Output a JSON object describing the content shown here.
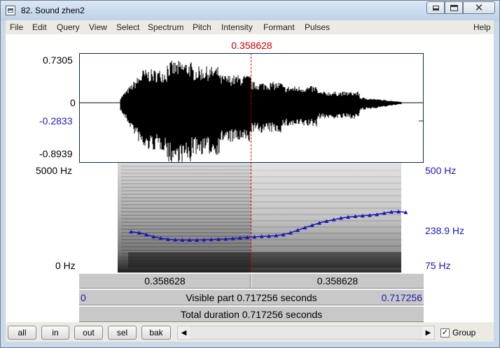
{
  "window": {
    "title": "82. Sound zhen2"
  },
  "menu": {
    "items": [
      "File",
      "Edit",
      "Query",
      "View",
      "Select",
      "Spectrum",
      "Pitch",
      "Intensity",
      "Formant",
      "Pulses"
    ],
    "help": "Help"
  },
  "cursor": {
    "time_label": "0.358628",
    "time": 0.358628
  },
  "waveform": {
    "y_max_label": "0.7305",
    "y_zero_label": "0",
    "y_value_label": "-0.2833",
    "y_min_label": "-0.8939",
    "ylim": [
      -0.8939,
      0.7305
    ]
  },
  "spectrogram": {
    "freq_top_label": "5000 Hz",
    "freq_bottom_label": "0 Hz",
    "pitch_top_label": "500 Hz",
    "pitch_value_label": "238.9 Hz",
    "pitch_bottom_label": "75 Hz",
    "pitch_range": [
      75,
      500
    ]
  },
  "chart_data": {
    "type": "line",
    "ylabel": "",
    "xlim": [
      0,
      0.717256
    ],
    "ylim": [
      75,
      500
    ],
    "series": [
      {
        "color": "#1a1ab5",
        "x": [
          0.108,
          0.125,
          0.14,
          0.155,
          0.17,
          0.185,
          0.2,
          0.215,
          0.23,
          0.245,
          0.26,
          0.275,
          0.29,
          0.305,
          0.32,
          0.335,
          0.35,
          0.365,
          0.38,
          0.395,
          0.41,
          0.425,
          0.44,
          0.455,
          0.47,
          0.485,
          0.5,
          0.515,
          0.53,
          0.545,
          0.56,
          0.575,
          0.59,
          0.605,
          0.62,
          0.635,
          0.65,
          0.665,
          0.68
        ],
        "y": [
          233,
          229,
          222,
          214,
          208,
          204,
          202,
          201,
          201,
          201,
          202,
          203,
          204,
          205,
          207,
          209,
          211,
          213,
          215,
          216,
          218,
          222,
          229,
          239,
          249,
          258,
          267,
          274,
          280,
          286,
          290,
          293,
          295,
          297,
          300,
          305,
          310,
          311,
          308
        ]
      }
    ]
  },
  "selection_bars": {
    "left_value": "0.358628",
    "right_value": "0.358628",
    "visible_start": "0",
    "visible_label": "Visible part 0.717256 seconds",
    "visible_end": "0.717256",
    "total_label": "Total duration 0.717256 seconds"
  },
  "buttons": {
    "all": "all",
    "in": "in",
    "out": "out",
    "sel": "sel",
    "bak": "bak"
  },
  "group": {
    "label": "Group",
    "checked": true
  }
}
